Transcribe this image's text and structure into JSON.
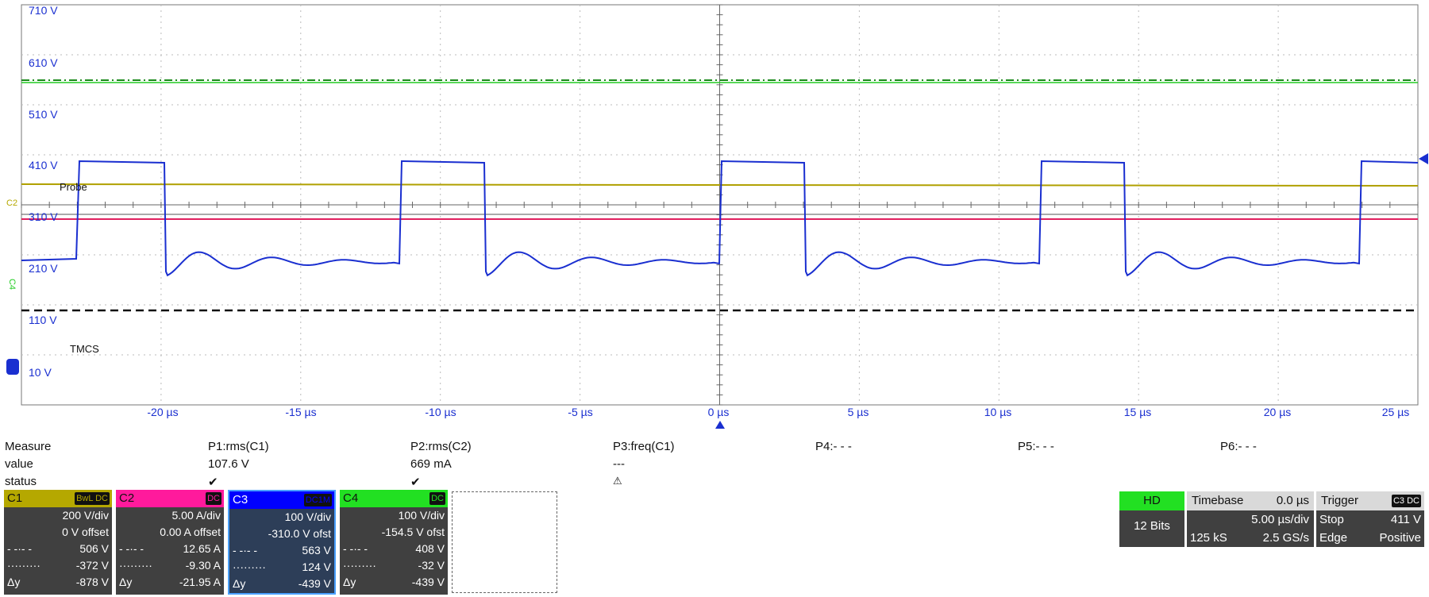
{
  "axis": {
    "y_ticks": [
      "710 V",
      "610 V",
      "510 V",
      "410 V",
      "310 V",
      "210 V",
      "110 V",
      "10 V"
    ],
    "x_ticks": [
      "-20 µs",
      "-15 µs",
      "-10 µs",
      "-5 µs",
      "0 µs",
      "5 µs",
      "10 µs",
      "15 µs",
      "20 µs",
      "25 µs"
    ],
    "channel_markers": [
      "C2",
      "C4"
    ],
    "labels": [
      "Probe",
      "TMCS"
    ]
  },
  "colors": {
    "c1": "#b5a800",
    "c2": "#ff1a9c",
    "c3": "#0000ff",
    "c4": "#22e022",
    "trace_blue": "#1a2fd0",
    "trace_yellow": "#b0a000",
    "trace_pink": "#e0205f",
    "trace_green": "#22cc22"
  },
  "measure": {
    "headers": [
      "Measure",
      "P1:rms(C1)",
      "P2:rms(C2)",
      "P3:freq(C1)",
      "P4:- - -",
      "P5:- - -",
      "P6:- - -"
    ],
    "value_row": [
      "value",
      "107.6 V",
      "669 mA",
      "---"
    ],
    "status_row": [
      "status",
      "✔",
      "✔",
      "⚠"
    ]
  },
  "channels": [
    {
      "name": "C1",
      "badge": "BwL DC",
      "vdiv": "200 V/div",
      "offset": "0 V offset",
      "dash_val": "506 V",
      "dot_val": "-372 V",
      "dy": "-878 V"
    },
    {
      "name": "C2",
      "badge": "DC",
      "vdiv": "5.00 A/div",
      "offset": "0.00 A offset",
      "dash_val": "12.65 A",
      "dot_val": "-9.30 A",
      "dy": "-21.95 A"
    },
    {
      "name": "C3",
      "badge": "DC1M",
      "vdiv": "100 V/div",
      "offset": "-310.0 V ofst",
      "dash_val": "563 V",
      "dot_val": "124 V",
      "dy": "-439 V"
    },
    {
      "name": "C4",
      "badge": "DC",
      "vdiv": "100 V/div",
      "offset": "-154.5 V ofst",
      "dash_val": "408 V",
      "dot_val": "-32 V",
      "dy": "-439 V"
    }
  ],
  "cursor_labels": {
    "dash": "- -·- -",
    "dot": "·········",
    "dy": "Δy"
  },
  "hd": {
    "label": "HD",
    "bits": "12 Bits"
  },
  "timebase": {
    "title": "Timebase",
    "delay": "0.0 µs",
    "per_div": "5.00 µs/div",
    "samples": "125 kS",
    "rate": "2.5 GS/s"
  },
  "trigger": {
    "title": "Trigger",
    "badge": "C3 DC",
    "mode": "Stop",
    "level": "411 V",
    "type": "Edge",
    "slope": "Positive"
  }
}
